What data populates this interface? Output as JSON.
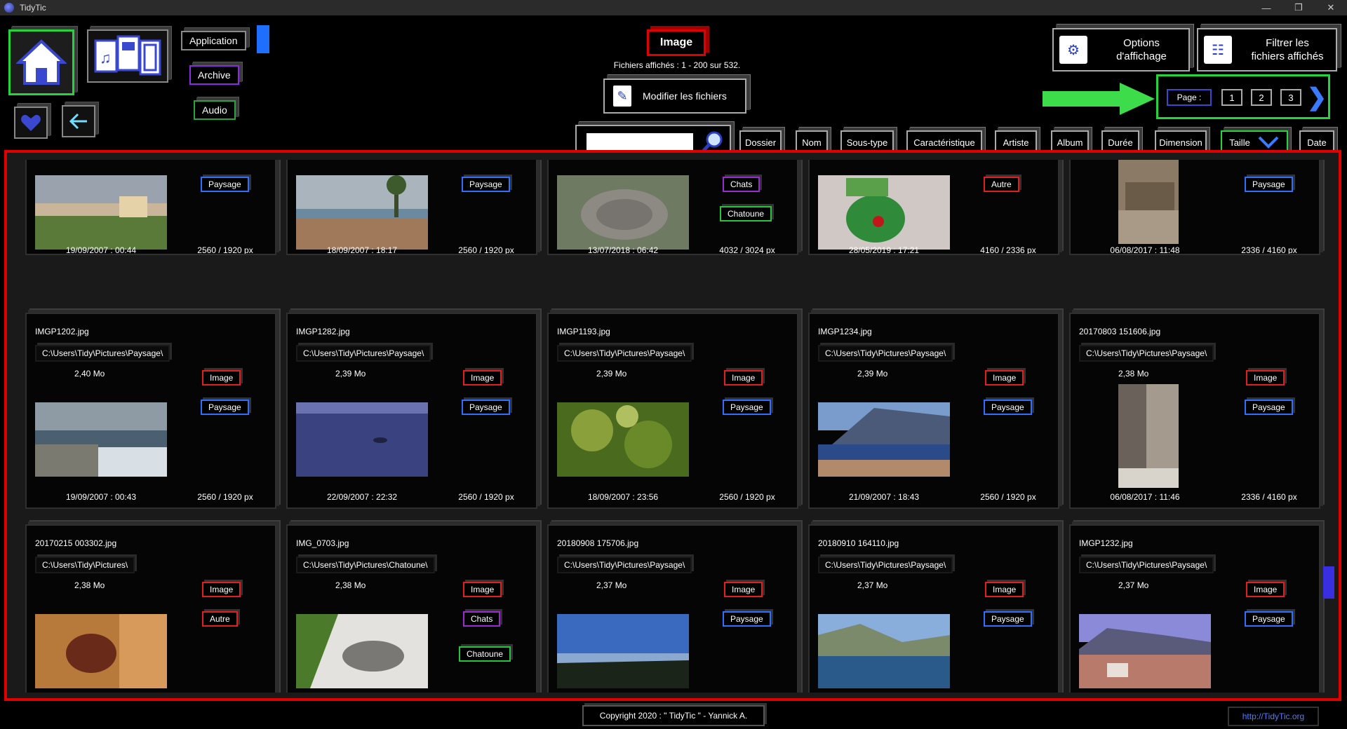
{
  "window": {
    "title": "TidyTic"
  },
  "nav": {
    "categories": [
      {
        "label": "Application"
      },
      {
        "label": "Archive"
      },
      {
        "label": "Audio"
      }
    ]
  },
  "type_selector": {
    "label": "Image"
  },
  "files_count": "Fichiers affichés : 1 - 200 sur 532.",
  "modify_button": {
    "label": "Modifier les fichiers"
  },
  "options_button": {
    "line1": "Options",
    "line2": "d'affichage"
  },
  "filter_button": {
    "line1": "Filtrer les",
    "line2": "fichiers affichés"
  },
  "pager": {
    "label": "Page :",
    "pages": [
      "1",
      "2",
      "3"
    ]
  },
  "search": {
    "value": "",
    "placeholder": ""
  },
  "sort_columns": [
    "Dossier",
    "Nom",
    "Sous-type",
    "Caractéristique",
    "Artiste",
    "Album",
    "Durée",
    "Dimension",
    "Taille",
    "Date"
  ],
  "cards_row1": [
    {
      "tags": [
        {
          "label": "Paysage",
          "color": "blue"
        }
      ],
      "date": "19/09/2007 : 00:44",
      "dims": "2560 / 1920 px",
      "thumb": "landscape-city"
    },
    {
      "tags": [
        {
          "label": "Paysage",
          "color": "blue"
        }
      ],
      "date": "18/09/2007 : 18:17",
      "dims": "2560 / 1920 px",
      "thumb": "landscape-palms"
    },
    {
      "tags": [
        {
          "label": "Chats",
          "color": "purple"
        },
        {
          "label": "Chatoune",
          "color": "green"
        }
      ],
      "date": "13/07/2018 : 06:42",
      "dims": "4032 / 3024 px",
      "thumb": "cat-sleeping"
    },
    {
      "tags": [
        {
          "label": "Autre",
          "color": "red"
        }
      ],
      "date": "28/05/2019 : 17:21",
      "dims": "4160 / 2336 px",
      "thumb": "green-figure"
    },
    {
      "tags": [
        {
          "label": "Paysage",
          "color": "blue"
        }
      ],
      "date": "06/08/2017 : 11:48",
      "dims": "2336 / 4160 px",
      "thumb": "tree-trunk-portrait"
    }
  ],
  "cards_row2": [
    {
      "name": "IMGP1202.jpg",
      "path": "C:\\Users\\Tidy\\Pictures\\Paysage\\",
      "size": "2,40 Mo",
      "tags": [
        {
          "label": "Image",
          "color": "red"
        },
        {
          "label": "Paysage",
          "color": "blue"
        }
      ],
      "date": "19/09/2007 : 00:43",
      "dims": "2560 / 1920 px",
      "thumb": "coast-town"
    },
    {
      "name": "IMGP1282.jpg",
      "path": "C:\\Users\\Tidy\\Pictures\\Paysage\\",
      "size": "2,39 Mo",
      "tags": [
        {
          "label": "Image",
          "color": "red"
        },
        {
          "label": "Paysage",
          "color": "blue"
        }
      ],
      "date": "22/09/2007 : 22:32",
      "dims": "2560 / 1920 px",
      "thumb": "sea-dolphin"
    },
    {
      "name": "IMGP1193.jpg",
      "path": "C:\\Users\\Tidy\\Pictures\\Paysage\\",
      "size": "2,39 Mo",
      "tags": [
        {
          "label": "Image",
          "color": "red"
        },
        {
          "label": "Paysage",
          "color": "blue"
        }
      ],
      "date": "18/09/2007 : 23:56",
      "dims": "2560 / 1920 px",
      "thumb": "pine-needles"
    },
    {
      "name": "IMGP1234.jpg",
      "path": "C:\\Users\\Tidy\\Pictures\\Paysage\\",
      "size": "2,39 Mo",
      "tags": [
        {
          "label": "Image",
          "color": "red"
        },
        {
          "label": "Paysage",
          "color": "blue"
        }
      ],
      "date": "21/09/2007 : 18:43",
      "dims": "2560 / 1920 px",
      "thumb": "cliffs-sea"
    },
    {
      "name": "20170803  151606.jpg",
      "path": "C:\\Users\\Tidy\\Pictures\\Paysage\\",
      "size": "2,38 Mo",
      "tags": [
        {
          "label": "Image",
          "color": "red"
        },
        {
          "label": "Paysage",
          "color": "blue"
        }
      ],
      "date": "06/08/2017 : 11:46",
      "dims": "2336 / 4160 px",
      "thumb": "rock-wall-portrait"
    }
  ],
  "cards_row3": [
    {
      "name": "20170215  003302.jpg",
      "path": "C:\\Users\\Tidy\\Pictures\\",
      "size": "2,38 Mo",
      "tags": [
        {
          "label": "Image",
          "color": "red"
        },
        {
          "label": "Autre",
          "color": "red"
        }
      ],
      "thumb": "figurine"
    },
    {
      "name": "IMG_0703.jpg",
      "path": "C:\\Users\\Tidy\\Pictures\\Chatoune\\",
      "size": "2,38 Mo",
      "tags": [
        {
          "label": "Image",
          "color": "red"
        },
        {
          "label": "Chats",
          "color": "purple"
        },
        {
          "label": "Chatoune",
          "color": "green"
        }
      ],
      "thumb": "cat-lying"
    },
    {
      "name": "20180908  175706.jpg",
      "path": "C:\\Users\\Tidy\\Pictures\\Paysage\\",
      "size": "2,37 Mo",
      "tags": [
        {
          "label": "Image",
          "color": "red"
        },
        {
          "label": "Paysage",
          "color": "blue"
        }
      ],
      "thumb": "lake-view"
    },
    {
      "name": "20180910  164110.jpg",
      "path": "C:\\Users\\Tidy\\Pictures\\Paysage\\",
      "size": "2,37 Mo",
      "tags": [
        {
          "label": "Image",
          "color": "red"
        },
        {
          "label": "Paysage",
          "color": "blue"
        }
      ],
      "thumb": "lake-mountains"
    },
    {
      "name": "IMGP1232.jpg",
      "path": "C:\\Users\\Tidy\\Pictures\\Paysage\\",
      "size": "2,37 Mo",
      "tags": [
        {
          "label": "Image",
          "color": "red"
        },
        {
          "label": "Paysage",
          "color": "blue"
        }
      ],
      "thumb": "cliffs-town"
    }
  ],
  "footer": {
    "copyright": "Copyright 2020 : \" TidyTic \" - Yannick A.",
    "link": "http://TidyTic.org"
  },
  "colors": {
    "accent_red": "#e10000",
    "accent_green": "#25d43a",
    "accent_blue": "#2f6fff",
    "accent_purple": "#9a2bd0"
  }
}
